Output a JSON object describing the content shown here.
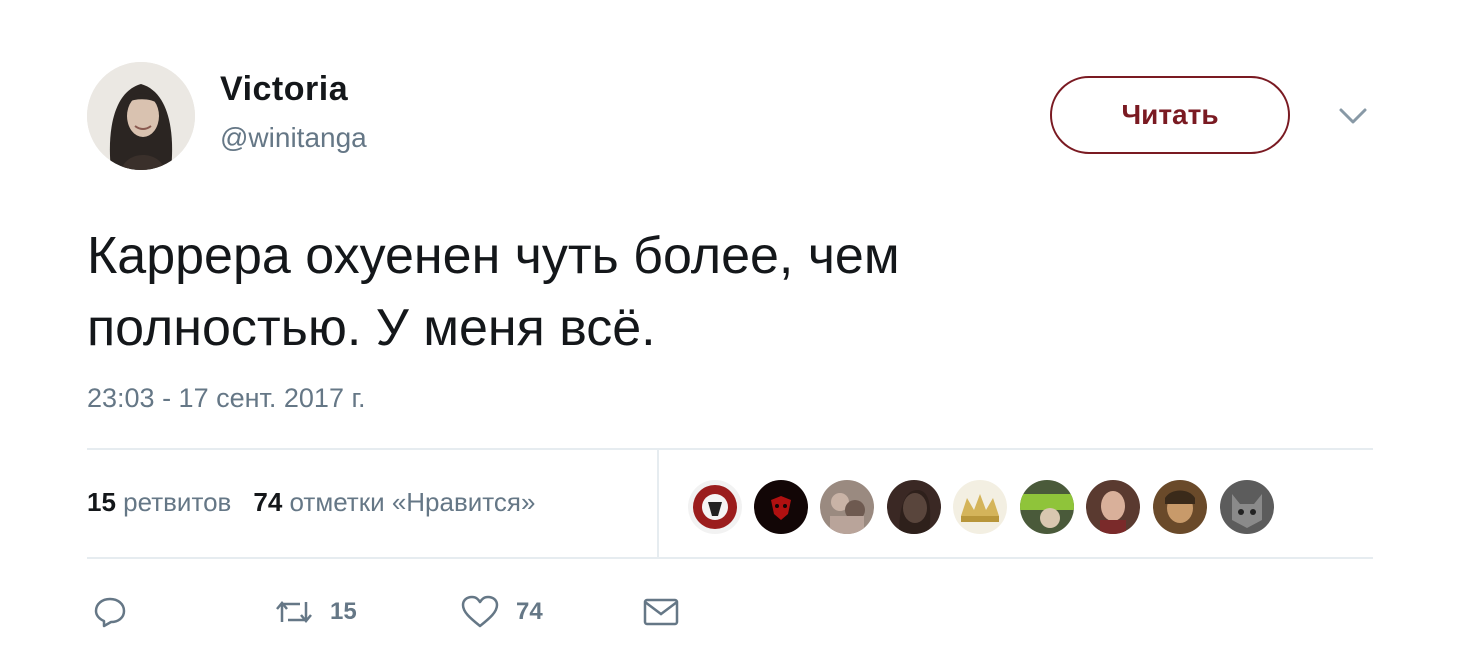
{
  "author": {
    "display_name": "Victoria",
    "handle": "@winitanga"
  },
  "follow_button_label": "Читать",
  "tweet": {
    "text_line1": "Каррера охуенен чуть более, чем",
    "text_line2": "полностью. У меня всё.",
    "timestamp": "23:03 - 17 сент. 2017 г."
  },
  "stats": {
    "retweets_count": "15",
    "retweets_label": "ретвитов",
    "likes_count": "74",
    "likes_label": "отметки «Нравится»"
  },
  "likers": [
    {
      "icon": "avatar-red-logo",
      "color": "#8a1c1c"
    },
    {
      "icon": "avatar-red-mask",
      "color": "#1a0a0a"
    },
    {
      "icon": "avatar-photo-1",
      "color": "#8c7a6e"
    },
    {
      "icon": "avatar-photo-2",
      "color": "#4a3530"
    },
    {
      "icon": "avatar-gold-crown",
      "color": "#d6c07a"
    },
    {
      "icon": "avatar-green",
      "color": "#6a8a3a"
    },
    {
      "icon": "avatar-photo-3",
      "color": "#7a4a3a"
    },
    {
      "icon": "avatar-photo-4",
      "color": "#8a6a3a"
    },
    {
      "icon": "avatar-gray",
      "color": "#6e6e6e"
    }
  ],
  "actions": {
    "retweet_count": "15",
    "like_count": "74"
  },
  "colors": {
    "follow_accent": "#7a1a22",
    "secondary_text": "#657786",
    "divider": "#e6ecf0"
  }
}
